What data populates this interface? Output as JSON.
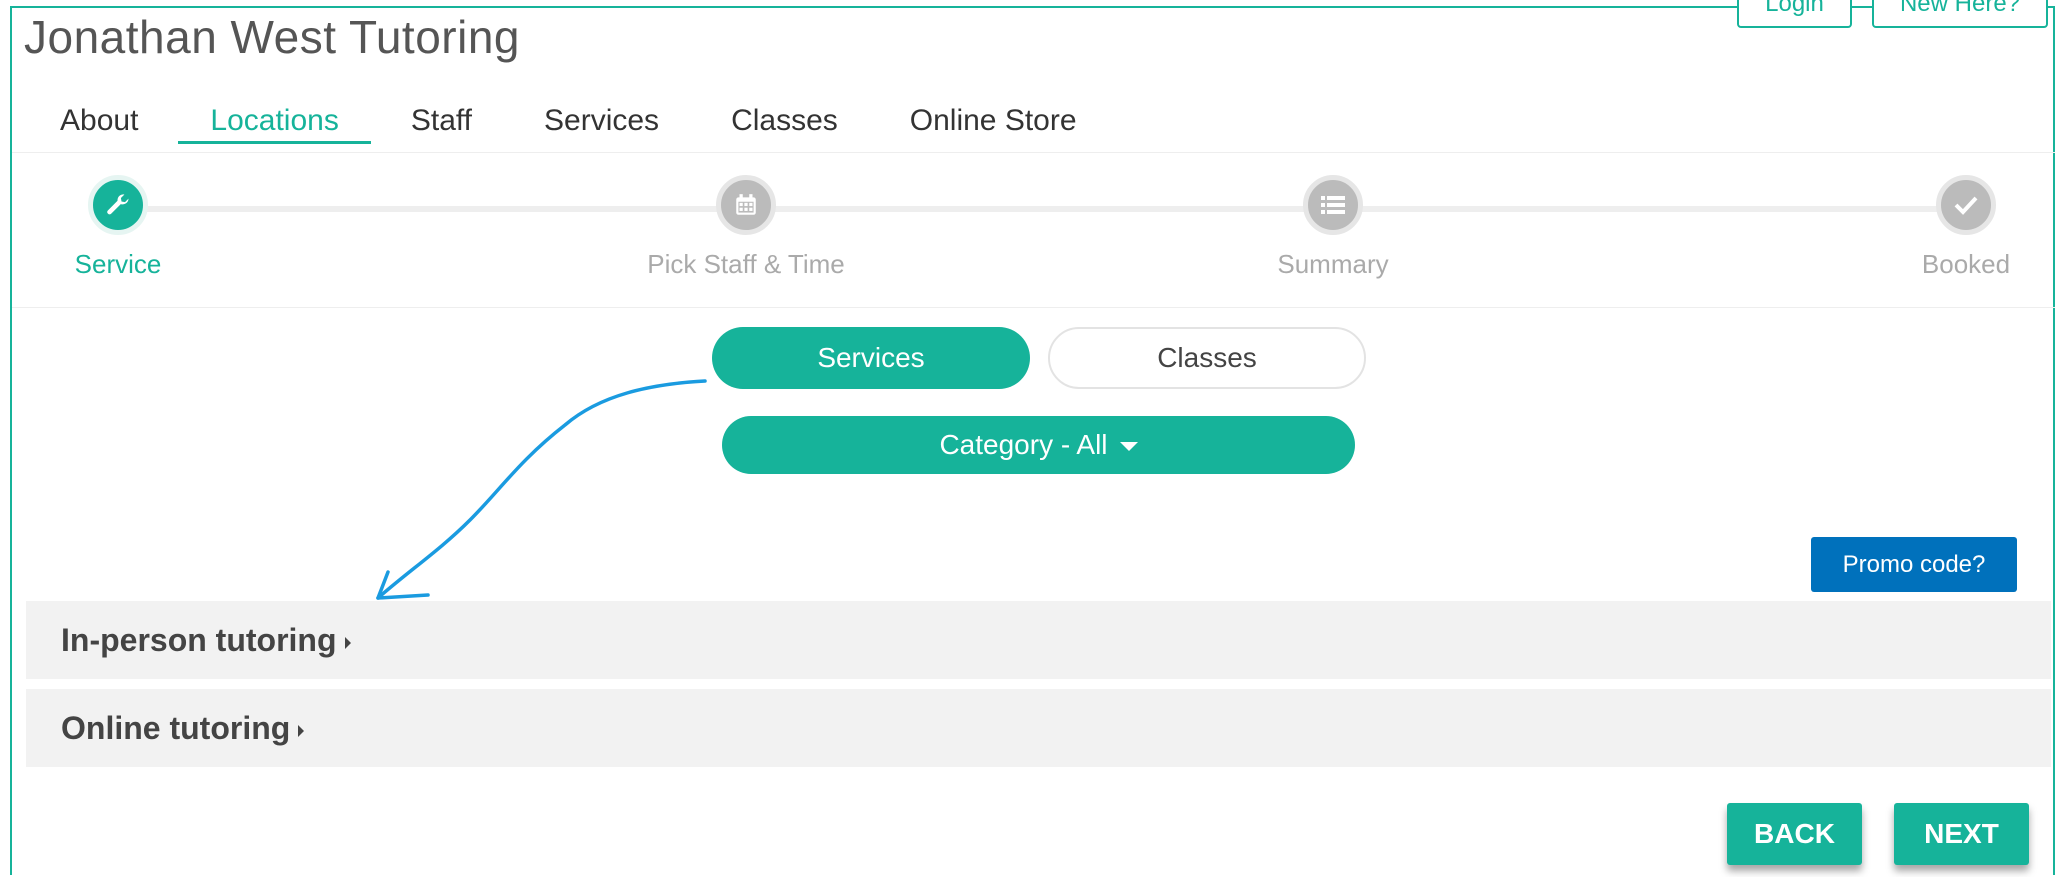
{
  "header": {
    "title": "Jonathan West Tutoring",
    "login_label": "Login",
    "new_here_label": "New Here?"
  },
  "nav": {
    "items": [
      {
        "label": "About"
      },
      {
        "label": "Locations"
      },
      {
        "label": "Staff"
      },
      {
        "label": "Services"
      },
      {
        "label": "Classes"
      },
      {
        "label": "Online Store"
      }
    ],
    "active": "Locations"
  },
  "steps": [
    {
      "label": "Service",
      "icon": "wrench-icon",
      "state": "current"
    },
    {
      "label": "Pick Staff & Time",
      "icon": "calendar-icon",
      "state": "pending"
    },
    {
      "label": "Summary",
      "icon": "list-icon",
      "state": "pending"
    },
    {
      "label": "Booked",
      "icon": "check-icon",
      "state": "pending"
    }
  ],
  "toggle": {
    "services_label": "Services",
    "classes_label": "Classes",
    "selected": "Services"
  },
  "category": {
    "label": "Category - All"
  },
  "promo": {
    "label": "Promo code?"
  },
  "service_groups": [
    {
      "label": "In-person tutoring"
    },
    {
      "label": "Online tutoring"
    }
  ],
  "actions": {
    "back_label": "BACK",
    "next_label": "NEXT"
  },
  "colors": {
    "accent": "#16b39a",
    "promo": "#0071bc",
    "annotation_arrow": "#1a9be0"
  }
}
